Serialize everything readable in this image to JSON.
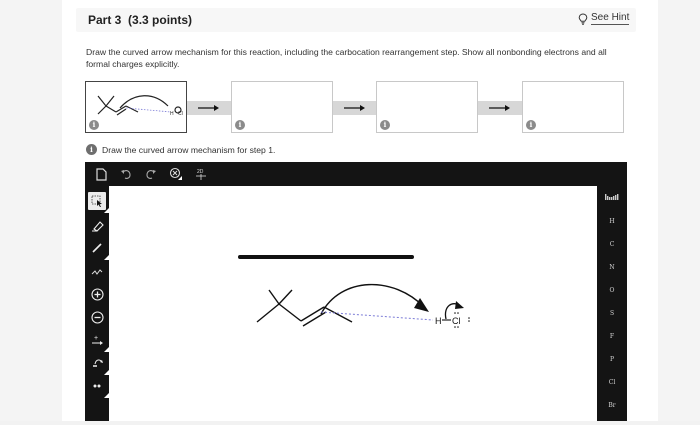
{
  "header": {
    "part_label": "Part 3",
    "points_label": "(3.3 points)",
    "hint_label": "See Hint",
    "hint_icon": "lightbulb-icon"
  },
  "instructions": "Draw the curved arrow mechanism for this reaction, including the carbocation rearrangement step. Show all nonbonding electrons and all formal charges explicitly.",
  "steps": [
    {
      "info_icon": "i"
    },
    {
      "info_icon": "i"
    },
    {
      "info_icon": "i"
    },
    {
      "info_icon": "i"
    }
  ],
  "subtitle": {
    "info_icon": "i",
    "text": "Draw the curved arrow mechanism for step 1."
  },
  "editor": {
    "top_toolbar": [
      "document-icon",
      "undo-icon",
      "redo-icon",
      "zoom-icon",
      "2d-template-icon"
    ],
    "template_label": "2D",
    "left_tools": [
      "select-icon",
      "eraser-icon",
      "bond-icon",
      "chain-icon",
      "plus-charge-icon",
      "minus-charge-icon",
      "arrow-icon",
      "curved-arrow-icon",
      "electrons-icon"
    ],
    "elements": [
      "H",
      "C",
      "N",
      "O",
      "S",
      "F",
      "P",
      "Cl",
      "Br"
    ],
    "periodic_icon": "periodic-table-icon",
    "molecule": {
      "atom_h": "H",
      "atom_cl": "Cl"
    }
  },
  "colors": {
    "editor_bg": "#141414",
    "canvas_bg": "#ffffff",
    "info_badge": "#8b8b8b",
    "arrow_band": "#d7d7d7",
    "dashed_bond": "#7b7bd6"
  }
}
